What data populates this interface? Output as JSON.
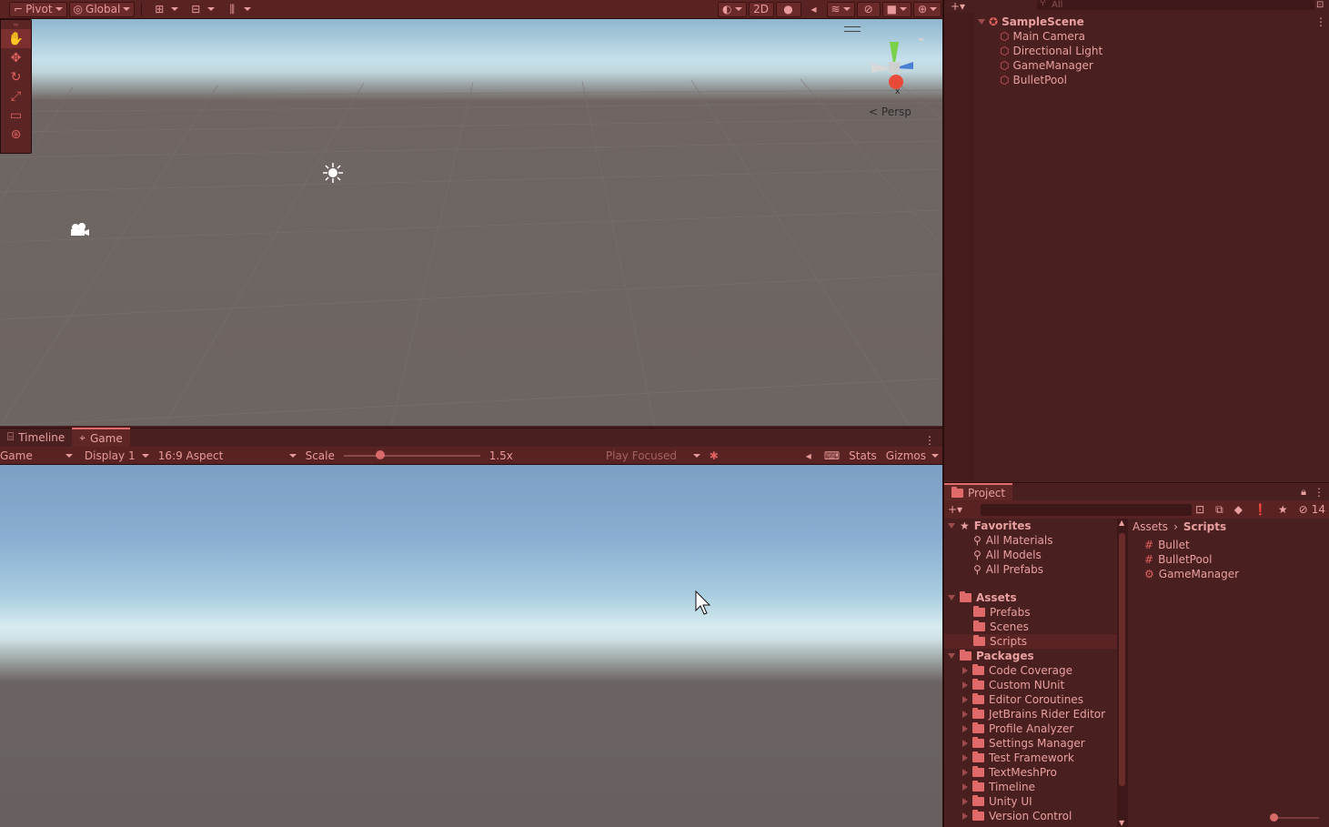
{
  "scene_toolbar": {
    "pivot_label": "Pivot",
    "global_label": "Global",
    "mode_2d_label": "2D"
  },
  "scene_view": {
    "persp_label": "Persp",
    "gizmo_axis_label": "x"
  },
  "game_tabs": {
    "timeline_label": "Timeline",
    "game_label": "Game"
  },
  "game_toolbar": {
    "view_select": "Game",
    "display_select": "Display 1",
    "aspect_select": "16:9 Aspect",
    "scale_label": "Scale",
    "scale_value": "1.5x",
    "play_focused_label": "Play Focused",
    "stats_label": "Stats",
    "gizmos_label": "Gizmos"
  },
  "hierarchy": {
    "search_placeholder": "All",
    "scene_name": "SampleScene",
    "objects": [
      "Main Camera",
      "Directional Light",
      "GameManager",
      "BulletPool"
    ]
  },
  "project": {
    "tab_label": "Project",
    "hidden_count": "14",
    "favorites_label": "Favorites",
    "favorites": [
      "All Materials",
      "All Models",
      "All Prefabs"
    ],
    "assets_label": "Assets",
    "asset_folders": [
      "Prefabs",
      "Scenes",
      "Scripts"
    ],
    "packages_label": "Packages",
    "packages": [
      "Code Coverage",
      "Custom NUnit",
      "Editor Coroutines",
      "JetBrains Rider Editor",
      "Profile Analyzer",
      "Settings Manager",
      "Test Framework",
      "TextMeshPro",
      "Timeline",
      "Unity UI",
      "Version Control"
    ],
    "breadcrumb_root": "Assets",
    "breadcrumb_current": "Scripts",
    "files": [
      "Bullet",
      "BulletPool",
      "GameManager"
    ]
  },
  "colors": {
    "panel_bg": "#4a1f1f",
    "toolbar_bg": "#5a2323",
    "accent": "#e26b6b",
    "text": "#e8a0a0"
  }
}
